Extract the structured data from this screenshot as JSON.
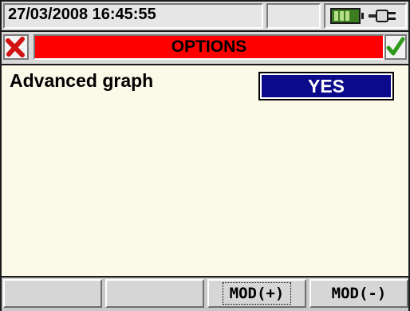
{
  "status": {
    "datetime": "27/03/2008 16:45:55",
    "icons": [
      "battery-icon",
      "power-plug-icon"
    ]
  },
  "title_bar": {
    "title": "OPTIONS",
    "close_icon": "close-icon",
    "confirm_icon": "confirm-check-icon",
    "title_color": "#ff0000"
  },
  "option": {
    "label": "Advanced graph",
    "value": "YES",
    "value_color": "#0a0a8a"
  },
  "softkeys": [
    {
      "label": ""
    },
    {
      "label": ""
    },
    {
      "label": "MOD(+)"
    },
    {
      "label": "MOD(-)"
    }
  ]
}
